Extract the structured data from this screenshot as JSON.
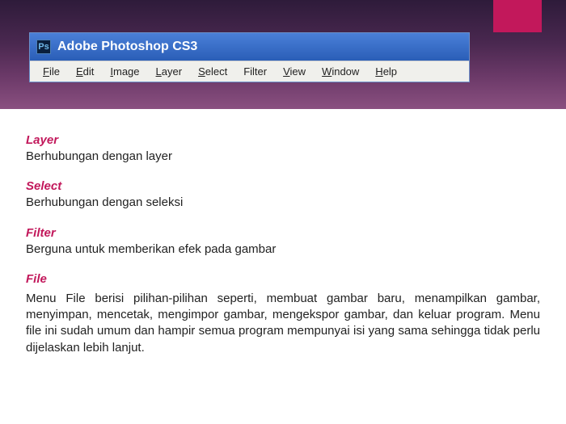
{
  "app": {
    "icon_label": "Ps",
    "title": "Adobe Photoshop CS3"
  },
  "menu": {
    "items": [
      {
        "hotkey": "F",
        "rest": "ile"
      },
      {
        "hotkey": "E",
        "rest": "dit"
      },
      {
        "hotkey": "I",
        "rest": "mage"
      },
      {
        "hotkey": "L",
        "rest": "ayer"
      },
      {
        "hotkey": "S",
        "rest": "elect"
      },
      {
        "hotkey": "",
        "rest": "Filter",
        "plain": true
      },
      {
        "hotkey": "V",
        "rest": "iew"
      },
      {
        "hotkey": "W",
        "rest": "indow"
      },
      {
        "hotkey": "H",
        "rest": "elp"
      }
    ]
  },
  "sections": {
    "layer": {
      "title": "Layer",
      "desc": "Berhubungan dengan layer"
    },
    "select": {
      "title": "Select",
      "desc": "Berhubungan dengan seleksi"
    },
    "filter": {
      "title": "Filter",
      "desc": "Berguna untuk memberikan efek pada gambar"
    },
    "file": {
      "title": "File",
      "desc": "Menu File berisi pilihan-pilihan seperti, membuat gambar baru, menampilkan gambar, menyimpan, mencetak, mengimpor gambar, mengekspor gambar, dan keluar program. Menu file ini sudah umum dan hampir semua program mempunyai isi yang sama sehingga tidak perlu dijelaskan lebih lanjut."
    }
  }
}
